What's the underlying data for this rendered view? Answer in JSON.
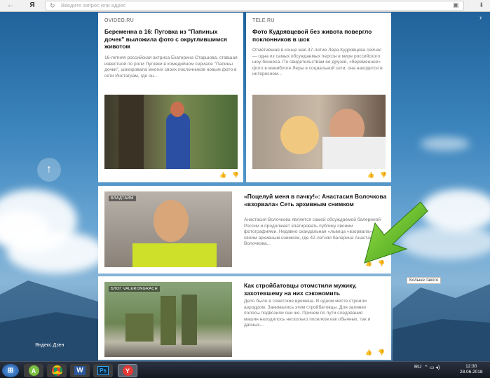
{
  "browser": {
    "logo": "Я",
    "address_placeholder": "Введите запрос или адрес"
  },
  "sidebar": {
    "up_icon": "arrow-up-icon",
    "brand": "Яндекс Дзен"
  },
  "feed": {
    "cards": [
      {
        "source": "OVIDEO.RU",
        "title": "Беременна в 16: Пуговка из \"Папиных дочек\" выложила фото с округлившимся животом",
        "snippet": "16-летняя российская актриса Екатерина Старшова, ставшая известной по роли Пуговки в комедийном сериале \"Папины дочки\", шокировала многих своих поклонников новым фото в сети Инстаграм, где он..."
      },
      {
        "source": "TELE.RU",
        "title": "Фото Кудрявцевой без живота повергло поклонников в шок",
        "snippet": "Отметившая в конце мая 47-летие Лера Кудрявцева сейчас — одна из самых обсуждаемых персон в мире российского шоу-бизнеса. По свидетельствам ее друзей, «беременное» фото в миниблоге Леры в социальной сети, она находится в интересном..."
      },
      {
        "source": "ВЛАДТАЙМ",
        "title": "«Поцелуй меня в пачку!»: Анастасия Волочкова «взорвала» Сеть архивным снимком",
        "snippet": "Анастасия Волочкова является самой обсуждаемой балериной России и продолжает эпатировать публику своими фотографиями. Недавно скандальная «львица «взорвала» Сеть своим архивным снимком, где 42-летняя балерина Анастасия Волочкова..."
      },
      {
        "source": "БЛОГ VALERONGRACH",
        "title": "Как стройбатовцы отомстили мужику, захотевшему на них сэкономить",
        "snippet": "Дело было в советские времена. В одном месте строили аэродром. Занимались этим стройбатовцы. Для заливки полосы подвозили они же. Причем по пути следования машин находилось несколько поселков как обычных, так и дачных..."
      }
    ],
    "like_icon": "thumbs-up-icon",
    "dislike_icon": "thumbs-down-icon"
  },
  "tooltip": "Больше такого",
  "taskbar": {
    "language": "RU",
    "time": "12:30",
    "date": "28.06.2018",
    "apps": [
      "start-icon",
      "android-icon",
      "chrome-icon",
      "word-icon",
      "photoshop-icon",
      "yandex-browser-icon"
    ],
    "word_label": "W",
    "ps_label": "Ps",
    "yandex_label": "Y",
    "android_label": "A"
  }
}
